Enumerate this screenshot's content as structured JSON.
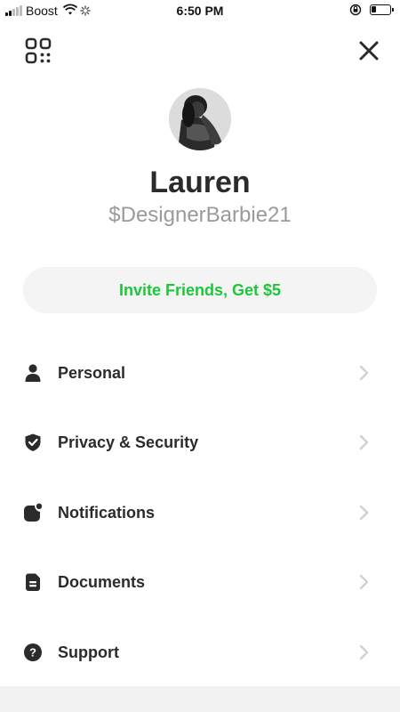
{
  "status_bar": {
    "carrier": "Boost",
    "time": "6:50 PM"
  },
  "profile": {
    "name": "Lauren",
    "cashtag": "$DesignerBarbie21"
  },
  "invite_button": {
    "label": "Invite Friends, Get $5",
    "color": "#1fc63b"
  },
  "menu": {
    "items": [
      {
        "icon": "person-icon",
        "label": "Personal"
      },
      {
        "icon": "shield-check-icon",
        "label": "Privacy & Security"
      },
      {
        "icon": "notification-icon",
        "label": "Notifications"
      },
      {
        "icon": "document-icon",
        "label": "Documents"
      },
      {
        "icon": "question-icon",
        "label": "Support"
      }
    ]
  },
  "icons": {
    "top_left": "qr-code-icon",
    "top_right": "close-icon"
  }
}
